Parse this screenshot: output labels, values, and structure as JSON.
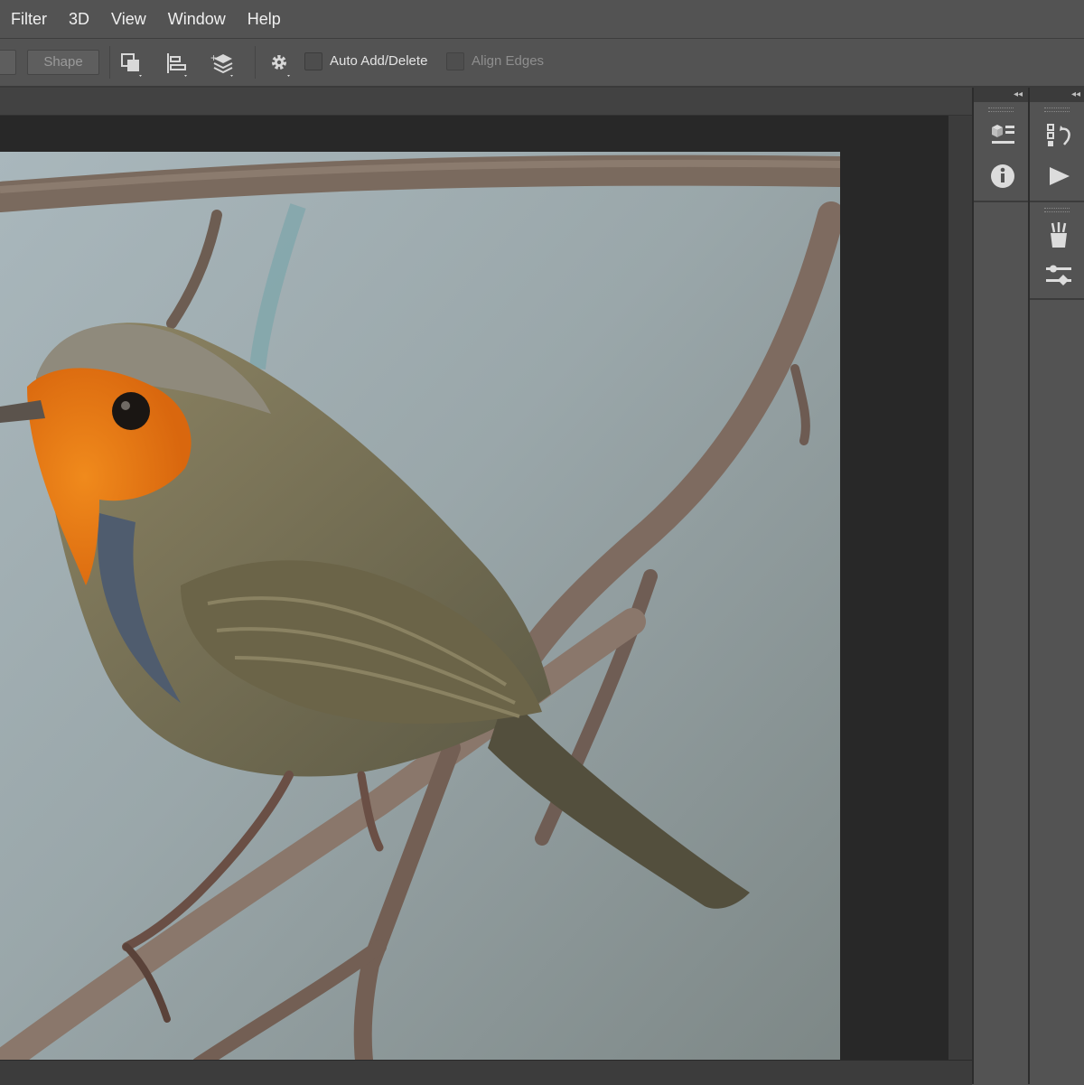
{
  "menu": [
    "Filter",
    "3D",
    "View",
    "Window",
    "Help"
  ],
  "options_bar": {
    "shape_button": "Shape",
    "auto_add_delete_label": "Auto Add/Delete",
    "align_edges_label": "Align Edges"
  },
  "dock": {
    "collapse_glyph_1": "◂◂",
    "collapse_glyph_2": "◂◂"
  },
  "colors": {
    "ui_bg": "#535353",
    "canvas_bg": "#282828",
    "panel_dark": "#3b3b3b"
  },
  "icons": [
    "path-operations-icon",
    "path-alignment-icon",
    "path-arrangement-icon",
    "gear-icon",
    "history-icon",
    "info-icon",
    "properties-icon",
    "play-actions-icon",
    "brush-presets-icon",
    "adjustments-icon"
  ]
}
